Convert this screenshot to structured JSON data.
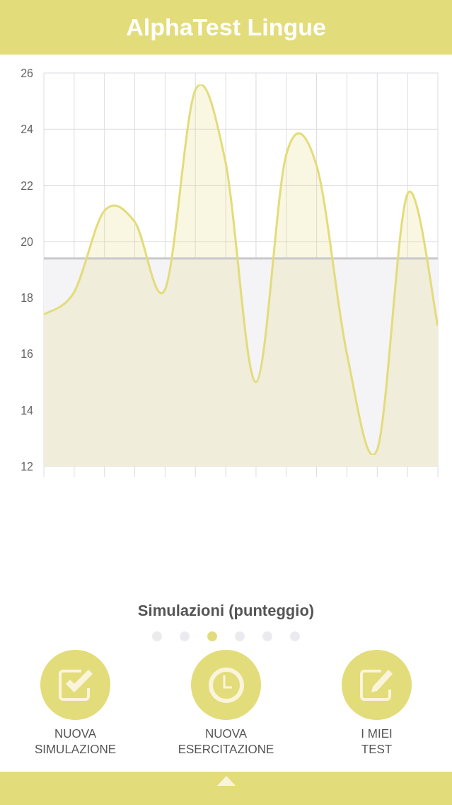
{
  "header": {
    "title": "AlphaTest Lingue"
  },
  "chart": {
    "chart_data": {
      "type": "area",
      "ylim": [
        12,
        26
      ],
      "yticks": [
        12,
        14,
        16,
        18,
        20,
        22,
        24,
        26
      ],
      "grid": true,
      "series": [
        {
          "color": "#c9c9cc",
          "values": [
            19.4,
            19.4,
            19.4,
            19.4,
            19.4,
            19.4,
            19.4,
            19.4,
            19.4,
            19.4,
            19.4,
            19.4,
            19.4,
            19.4
          ]
        },
        {
          "color": "#e3dc7a",
          "values": [
            17.4,
            18.2,
            21.1,
            20.7,
            18.3,
            25.4,
            22.8,
            15.0,
            23.1,
            22.7,
            16.0,
            12.6,
            21.7,
            17.0
          ]
        }
      ]
    }
  },
  "chart_title": "Simulazioni (punteggio)",
  "pager": [
    {
      "selected": false
    },
    {
      "selected": false
    },
    {
      "selected": true
    },
    {
      "selected": false
    },
    {
      "selected": false
    },
    {
      "selected": false
    }
  ],
  "actions": [
    {
      "kind": "check",
      "label": "NUOVA\nSIMULAZIONE"
    },
    {
      "kind": "clock",
      "label": "NUOVA\nESERCITAZIONE"
    },
    {
      "kind": "edit",
      "label": "I MIEI\nTEST"
    }
  ],
  "bottom_bar": {
    "kind": "expand"
  }
}
